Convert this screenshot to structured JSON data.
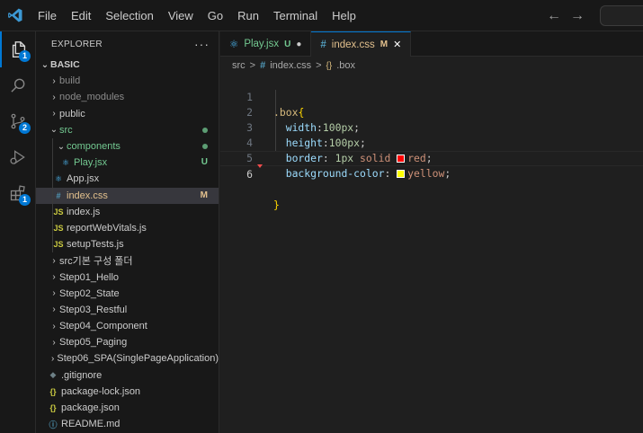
{
  "menu": [
    "File",
    "Edit",
    "Selection",
    "View",
    "Go",
    "Run",
    "Terminal",
    "Help"
  ],
  "activity": {
    "explorer_badge": "1",
    "scm_badge": "2",
    "extensions_badge": "1"
  },
  "explorer": {
    "title": "EXPLORER",
    "more": "···",
    "root": "BASIC",
    "items": [
      {
        "label": "build"
      },
      {
        "label": "node_modules"
      },
      {
        "label": "public"
      },
      {
        "label": "src"
      },
      {
        "label": "components"
      },
      {
        "label": "Play.jsx",
        "status": "U"
      },
      {
        "label": "App.jsx"
      },
      {
        "label": "index.css",
        "status": "M"
      },
      {
        "label": "index.js",
        "icon": "JS"
      },
      {
        "label": "reportWebVitals.js",
        "icon": "JS"
      },
      {
        "label": "setupTests.js",
        "icon": "JS"
      },
      {
        "label": "src기본 구성 폴더"
      },
      {
        "label": "Step01_Hello"
      },
      {
        "label": "Step02_State"
      },
      {
        "label": "Step03_Restful"
      },
      {
        "label": "Step04_Component"
      },
      {
        "label": "Step05_Paging"
      },
      {
        "label": "Step06_SPA(SinglePageApplication)"
      },
      {
        "label": ".gitignore"
      },
      {
        "label": "package-lock.json",
        "icon": "{}"
      },
      {
        "label": "package.json",
        "icon": "{}"
      },
      {
        "label": "README.md"
      }
    ]
  },
  "tabs": [
    {
      "label": "Play.jsx",
      "status": "U",
      "dirty": "●"
    },
    {
      "label": "index.css",
      "status": "M",
      "close": "✕"
    }
  ],
  "breadcrumb": [
    "src",
    ">",
    "index.css",
    ">",
    ".box"
  ],
  "editor": {
    "lines": [
      "1",
      "2",
      "3",
      "4",
      "5",
      "6"
    ],
    "selector": ".box",
    "open_brace": "{",
    "close_brace": "}",
    "width_prop": "width",
    "width_val": "100px",
    "height_prop": "height",
    "height_val": "100px",
    "border_prop": "border",
    "border_val_num": "1px",
    "border_val_style": "solid",
    "border_color": "red",
    "bg_prop": "background-color",
    "bg_color": "yellow",
    "colon": ":",
    "semicolon": ";",
    "swatch_red": "#ff0000",
    "swatch_yellow": "#ffff00"
  },
  "colors": {
    "accent": "#0078d4",
    "untracked": "#73c991",
    "modified": "#e2c08d"
  }
}
